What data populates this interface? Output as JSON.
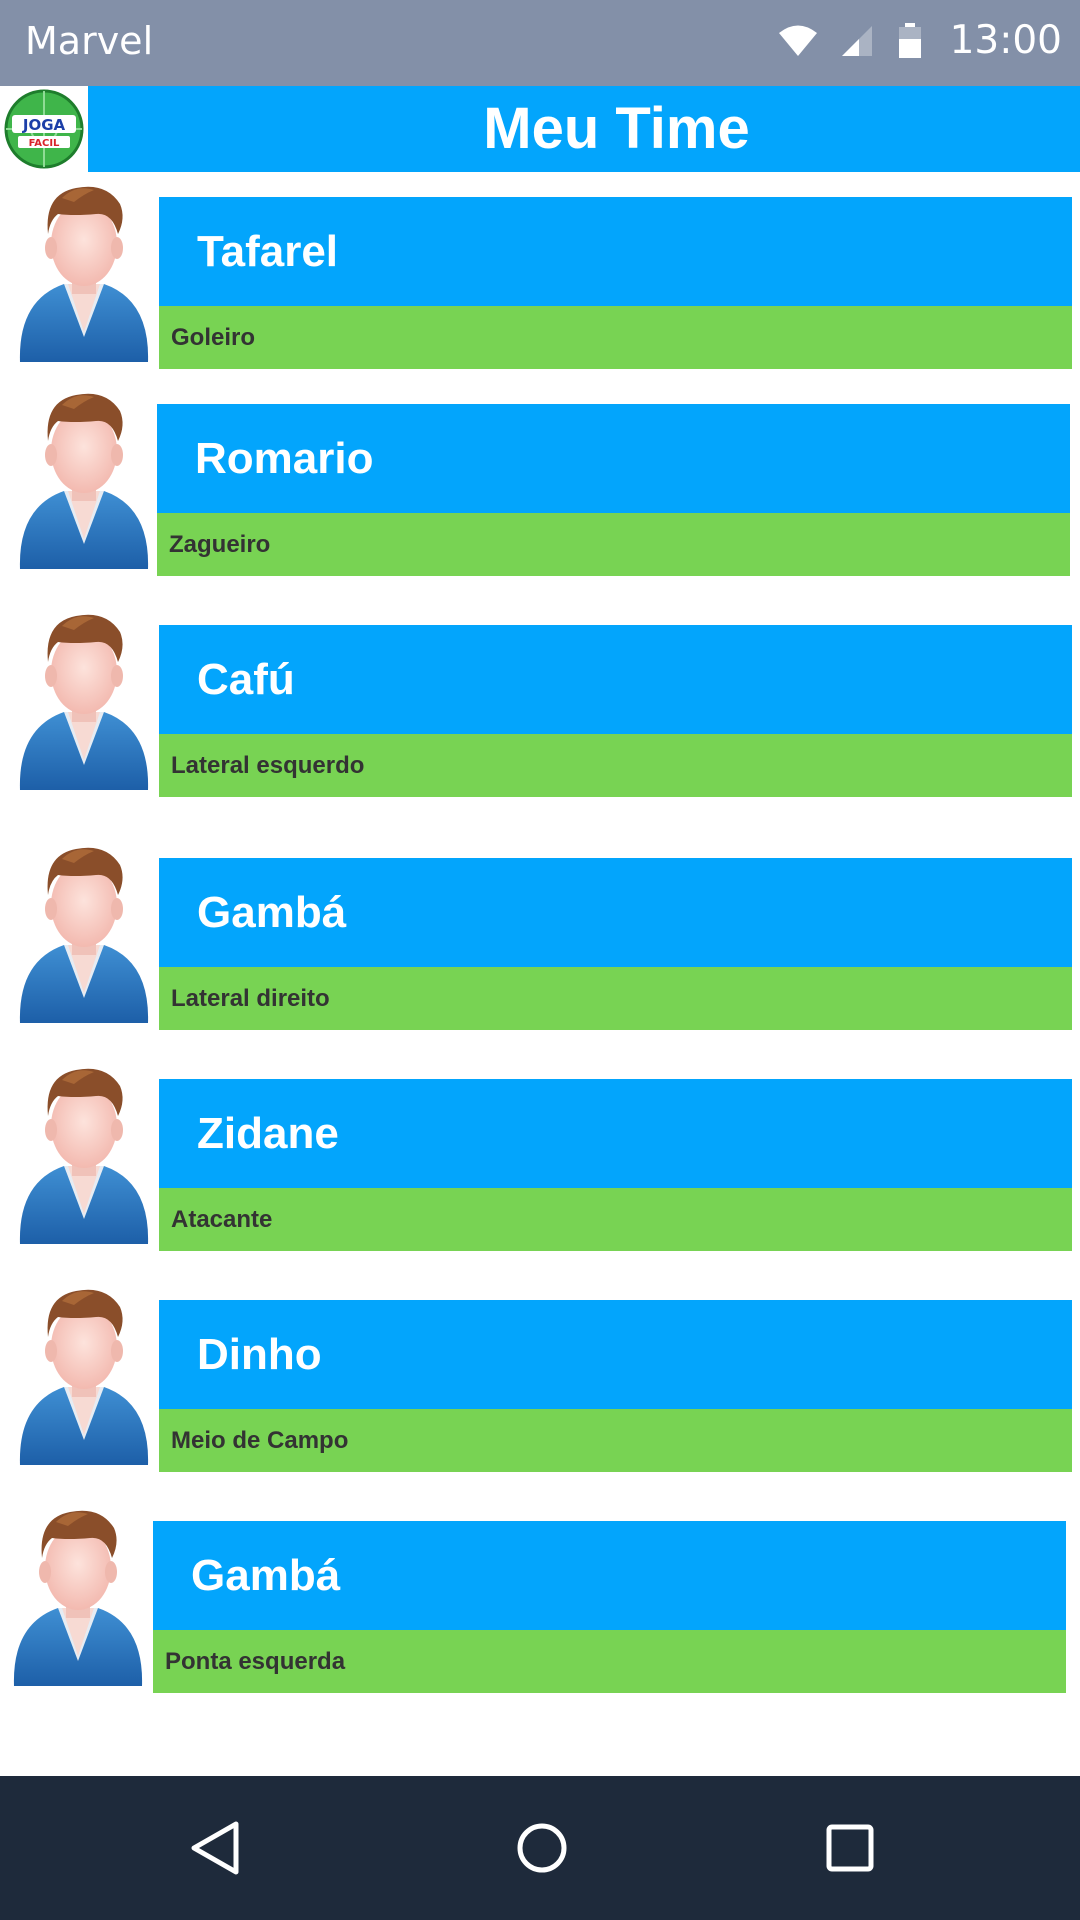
{
  "status_bar": {
    "app_name": "Marvel",
    "time": "13:00",
    "icons": [
      "wifi-icon",
      "cell-signal-icon",
      "battery-icon"
    ]
  },
  "header": {
    "logo_text": "JOGA FACIL",
    "title": "Meu Time"
  },
  "players": [
    {
      "name": "Tafarel",
      "position": "Goleiro"
    },
    {
      "name": "Romario",
      "position": "Zagueiro"
    },
    {
      "name": "Cafú",
      "position": "Lateral esquerdo"
    },
    {
      "name": "Gambá",
      "position": "Lateral direito"
    },
    {
      "name": "Zidane",
      "position": "Atacante"
    },
    {
      "name": "Dinho",
      "position": "Meio de Campo"
    },
    {
      "name": "Gambá",
      "position": "Ponta esquerda"
    }
  ],
  "nav_bar": {
    "buttons": [
      "back-icon",
      "home-icon",
      "recents-icon"
    ]
  },
  "colors": {
    "status_bar": "#8390a8",
    "header": "#03a5fc",
    "card_name": "#03a5fc",
    "card_role": "#78d353",
    "nav_bar": "#1e2a3b"
  }
}
